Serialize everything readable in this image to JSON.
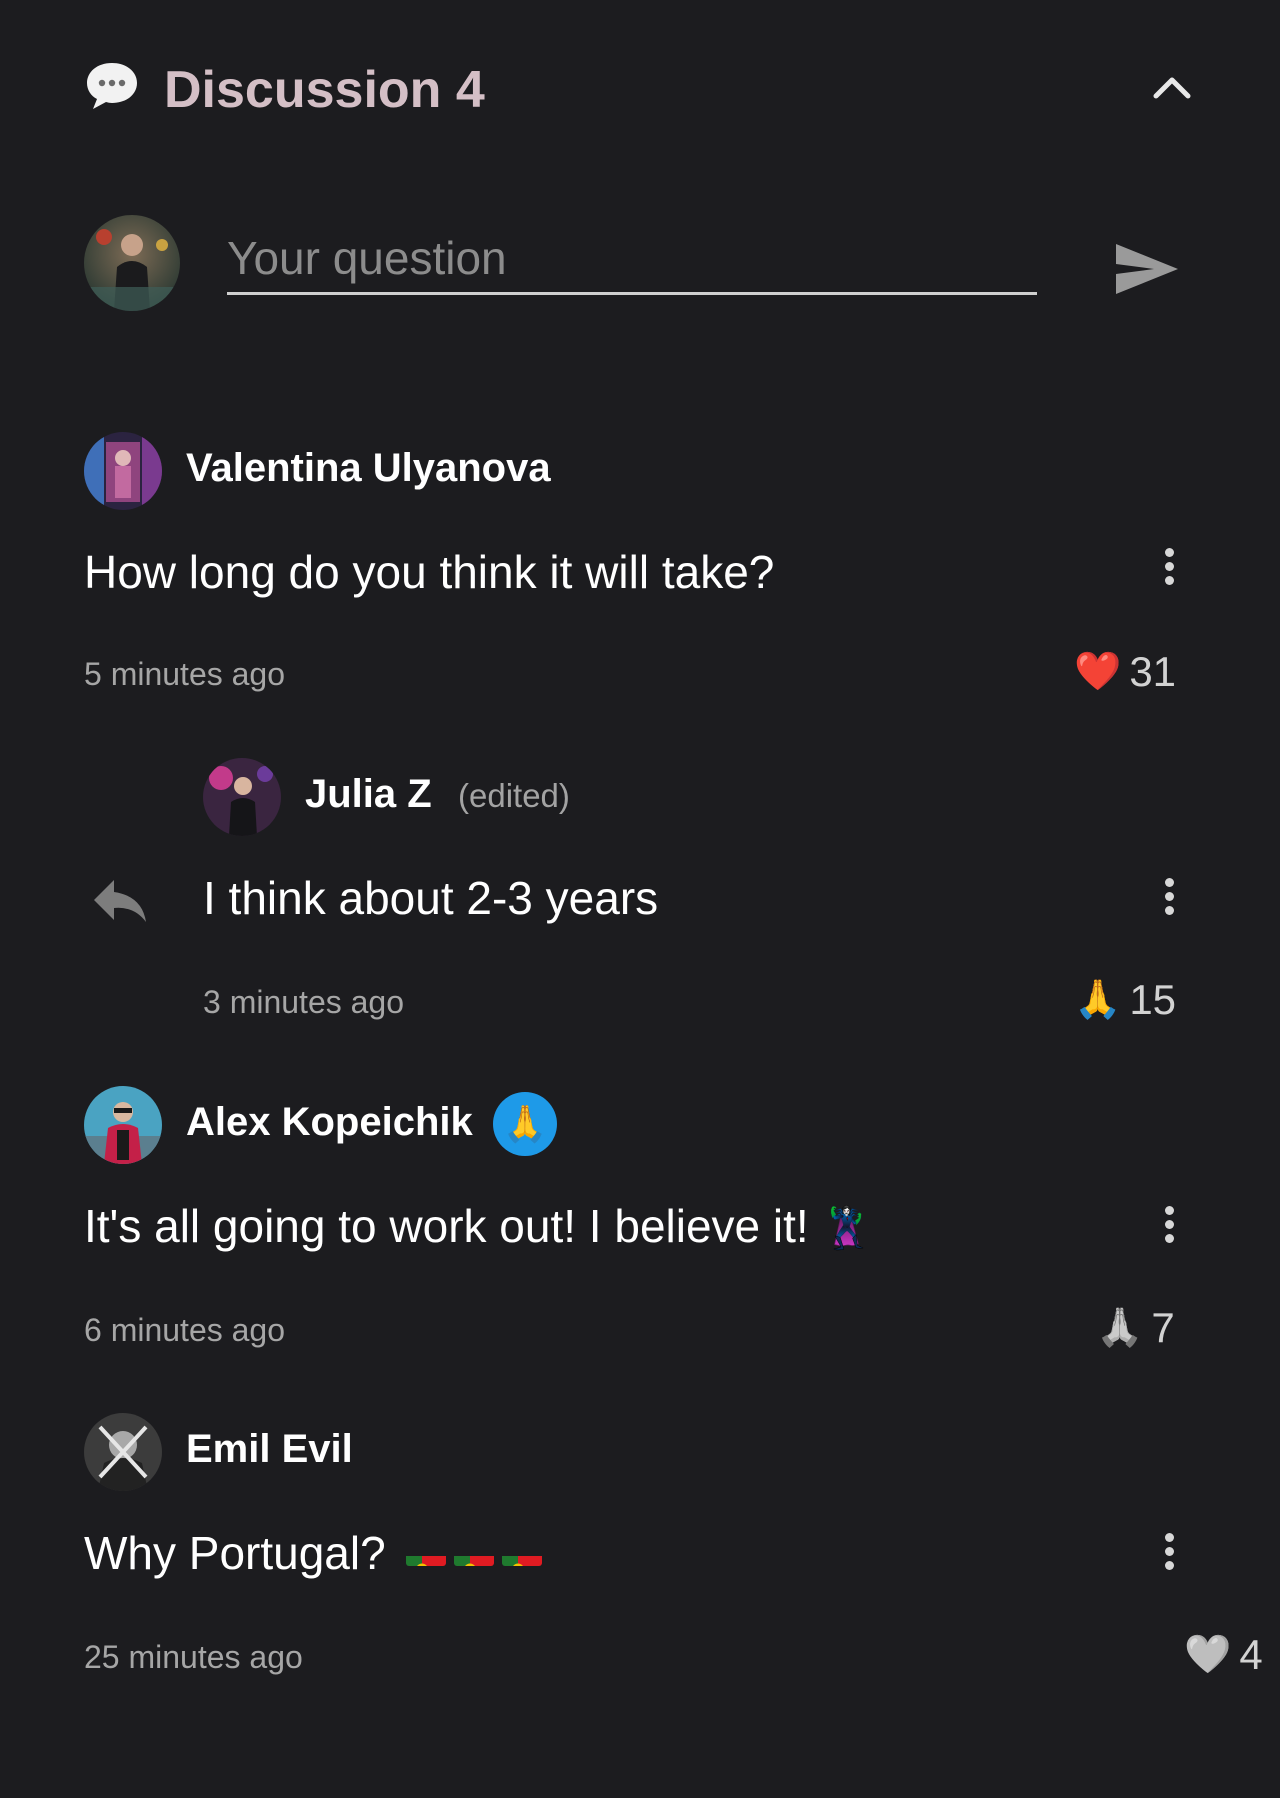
{
  "header": {
    "title": "Discussion 4",
    "icon": "speech-bubble-icon",
    "collapse_icon": "chevron-up-icon"
  },
  "composer": {
    "placeholder": "Your question",
    "value": "",
    "send_icon": "send-icon"
  },
  "comments": [
    {
      "author": "Valentina Ulyanova",
      "text": "How long do you think it will take?",
      "time": "5 minutes ago",
      "reaction_emoji": "❤️",
      "reaction_count": "31"
    },
    {
      "author": "Julia Z",
      "edited": "(edited)",
      "text": "I think about 2-3 years",
      "time": "3 minutes ago",
      "reaction_emoji": "🙏",
      "reaction_count": "15",
      "is_reply": true
    },
    {
      "author": "Alex Kopeichik",
      "badge_emoji": "🙏",
      "text": "It's all going to work out! I believe it!",
      "text_emoji": "🦹‍♀️",
      "time": "6 minutes ago",
      "reaction_emoji": "🙏",
      "reaction_count": "7"
    },
    {
      "author": "Emil Evil",
      "text": "Why Portugal?",
      "time": "25 minutes ago",
      "reaction_emoji": "🤍",
      "reaction_count": "4"
    }
  ],
  "colors": {
    "background": "#1c1c1f",
    "title": "#d4bfc6",
    "badge": "#1e9ae8",
    "heart": "#e0202e"
  }
}
